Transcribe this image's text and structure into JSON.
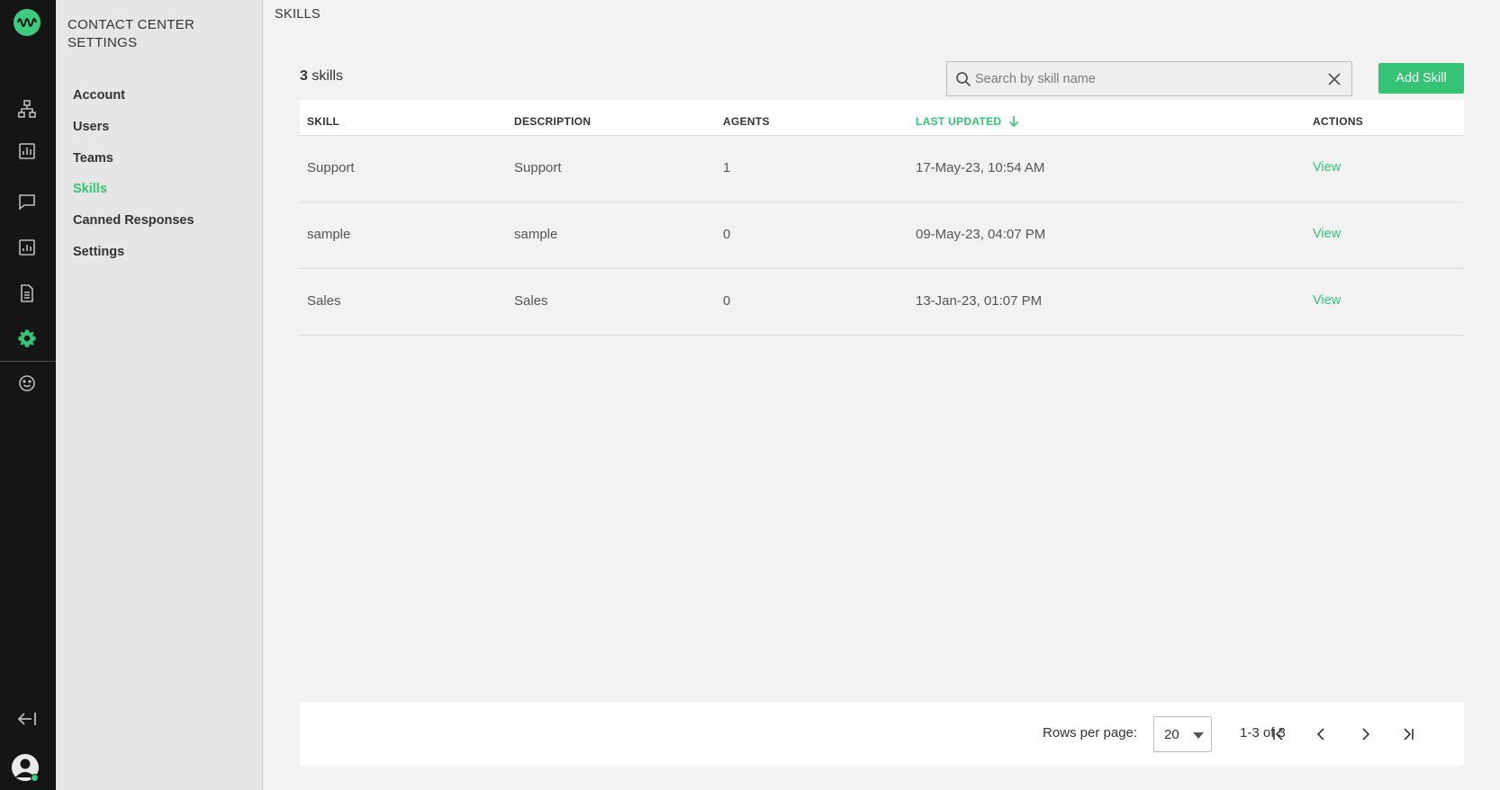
{
  "rail": {
    "items": [
      {
        "name": "org-chart-icon"
      },
      {
        "name": "analytics-icon"
      },
      {
        "name": "chat-icon"
      },
      {
        "name": "reports-icon"
      },
      {
        "name": "document-icon"
      },
      {
        "name": "settings-icon"
      },
      {
        "name": "smiley-icon"
      }
    ],
    "active_color": "#34c374"
  },
  "settings_nav": {
    "title": "CONTACT CENTER SETTINGS",
    "items": [
      {
        "label": "Account"
      },
      {
        "label": "Users"
      },
      {
        "label": "Teams"
      },
      {
        "label": "Skills",
        "active": true
      },
      {
        "label": "Canned Responses"
      },
      {
        "label": "Settings"
      }
    ]
  },
  "page": {
    "title": "SKILLS",
    "count_number": "3",
    "count_unit": " skills",
    "search_placeholder": "Search by skill name",
    "add_button": "Add Skill"
  },
  "table": {
    "headers": {
      "skill": "SKILL",
      "description": "DESCRIPTION",
      "agents": "AGENTS",
      "last_updated": "LAST UPDATED",
      "actions": "ACTIONS"
    },
    "rows": [
      {
        "skill": "Support",
        "description": "Support",
        "agents": "1",
        "last_updated": "17-May-23, 10:54 AM",
        "action": "View"
      },
      {
        "skill": "sample",
        "description": "sample",
        "agents": "0",
        "last_updated": "09-May-23, 04:07 PM",
        "action": "View"
      },
      {
        "skill": "Sales",
        "description": "Sales",
        "agents": "0",
        "last_updated": "13-Jan-23, 01:07 PM",
        "action": "View"
      }
    ]
  },
  "pagination": {
    "rows_per_page_label": "Rows per page:",
    "rows_per_page_value": "20",
    "range": "1-3 of 3"
  },
  "colors": {
    "accent": "#34c374",
    "rail_bg": "#151515",
    "sidebar_bg": "#e6e6e6",
    "content_bg": "#f2f2f2"
  }
}
